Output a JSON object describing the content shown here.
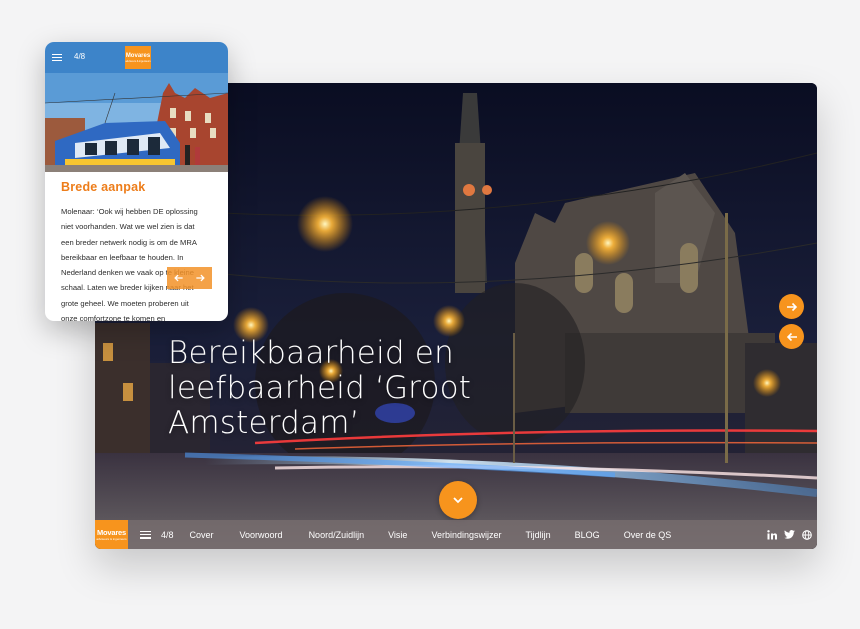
{
  "colors": {
    "accent": "#f7941d",
    "mobile_header": "#3d84c9",
    "heading": "#ed7d1a"
  },
  "brand": {
    "logo_text": "Movares",
    "logo_subtext": "adviseurs & ingenieurs"
  },
  "desktop": {
    "hero_title": "Bereikbaarheid en leefbaarheid ‘Groot Amsterdam’",
    "side_arrows": [
      {
        "icon": "arrow-right-icon"
      },
      {
        "icon": "arrow-left-icon"
      }
    ],
    "scroll_icon": "chevron-down-icon",
    "nav": {
      "menu_icon": "hamburger-icon",
      "page_indicator": "4/8",
      "items": [
        "Cover",
        "Voorwoord",
        "Noord/Zuidlijn",
        "Visie",
        "Verbindingswijzer",
        "Tijdlijn",
        "BLOG",
        "Over de QS"
      ],
      "socials": [
        "linkedin-icon",
        "twitter-icon",
        "globe-icon"
      ],
      "social_labels": [
        "in",
        "🐦",
        "🌐"
      ]
    }
  },
  "mobile": {
    "page_indicator": "4/8",
    "heading": "Brede aanpak",
    "body": "Molenaar: ‘Ook wij hebben DE oplossing\nniet voorhanden. Wat we wel zien is dat\neen breder netwerk nodig is om de MRA\nbereikbaar en leefbaar te houden. In\nNederland denken we vaak op te kleine\nschaal.  Laten we breder kijken naar het\ngrote geheel. We moeten proberen uit\nonze comfortzone te komen en"
  }
}
